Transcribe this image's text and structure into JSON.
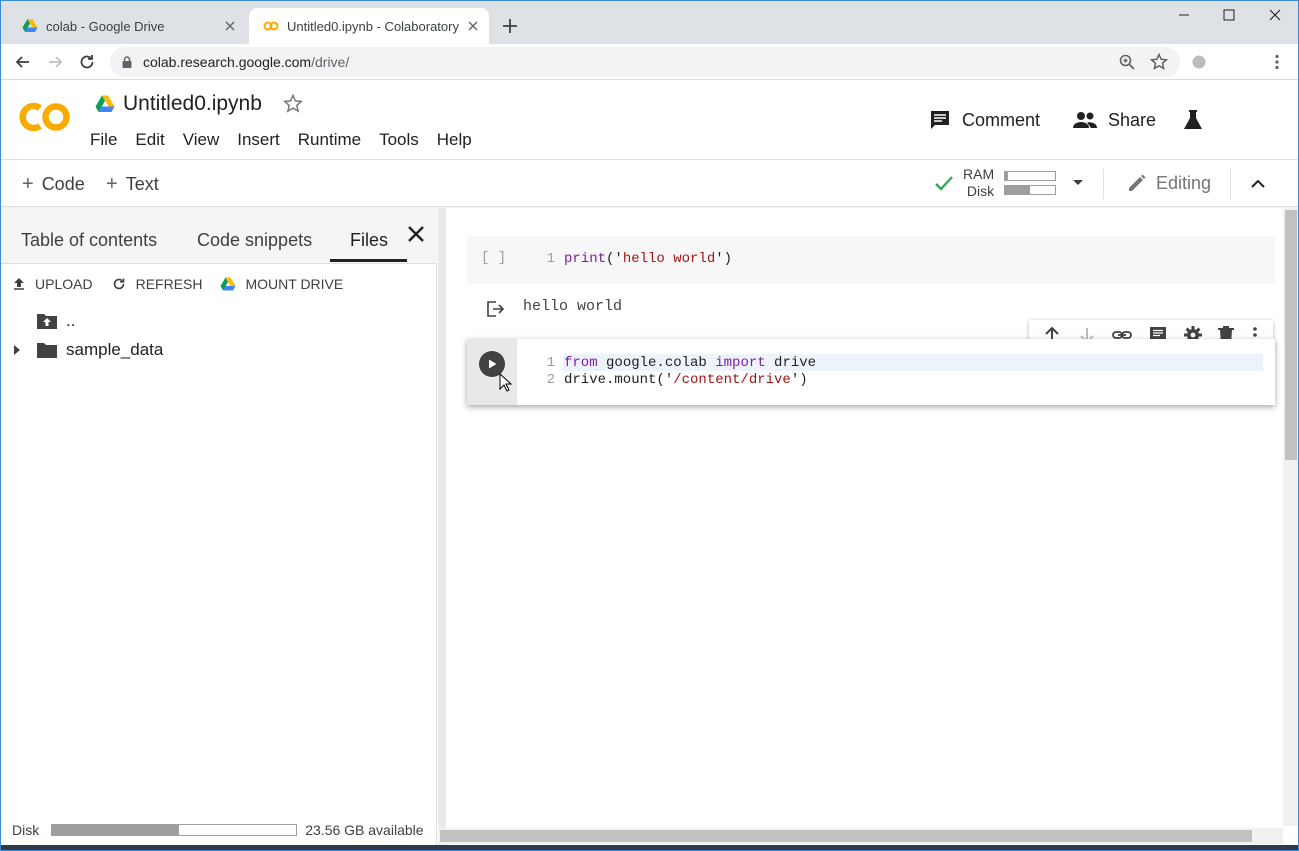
{
  "browser": {
    "tabs": [
      {
        "title": "colab - Google Drive",
        "icon": "google-drive-icon",
        "active": false
      },
      {
        "title": "Untitled0.ipynb - Colaboratory",
        "icon": "colab-icon",
        "active": true
      }
    ],
    "url_host": "colab.research.google.com",
    "url_path": "/drive/"
  },
  "header": {
    "notebook_title": "Untitled0.ipynb",
    "menu": [
      "File",
      "Edit",
      "View",
      "Insert",
      "Runtime",
      "Tools",
      "Help"
    ],
    "comment_label": "Comment",
    "share_label": "Share"
  },
  "toolbar": {
    "add_code": "Code",
    "add_text": "Text",
    "ram_label": "RAM",
    "disk_label": "Disk",
    "ram_usage": 0.05,
    "disk_usage": 0.5,
    "editing_label": "Editing",
    "status_color": "#34a853"
  },
  "sidebar": {
    "tabs": [
      "Table of contents",
      "Code snippets",
      "Files"
    ],
    "active_tab": "Files",
    "actions": {
      "upload": "UPLOAD",
      "refresh": "REFRESH",
      "mount": "MOUNT DRIVE"
    },
    "tree": [
      {
        "name": "..",
        "icon": "folder-up-icon"
      },
      {
        "name": "sample_data",
        "icon": "folder-icon"
      }
    ],
    "disk_label": "Disk",
    "disk_usage": 0.52,
    "disk_available": "23.56 GB available"
  },
  "cells": [
    {
      "exec": "[ ]",
      "lines": [
        {
          "num": "1",
          "parts": [
            {
              "t": "print",
              "c": "plain"
            },
            {
              "t": "('",
              "c": "plain"
            },
            {
              "t": "hello world",
              "c": "str"
            },
            {
              "t": "')",
              "c": "plain"
            }
          ]
        }
      ],
      "output": "hello world"
    },
    {
      "lines": [
        {
          "num": "1",
          "text": "from google.colab import drive"
        },
        {
          "num": "2",
          "text": "drive.mount('/content/drive')"
        }
      ]
    }
  ],
  "accent_color": "#f9ab00"
}
